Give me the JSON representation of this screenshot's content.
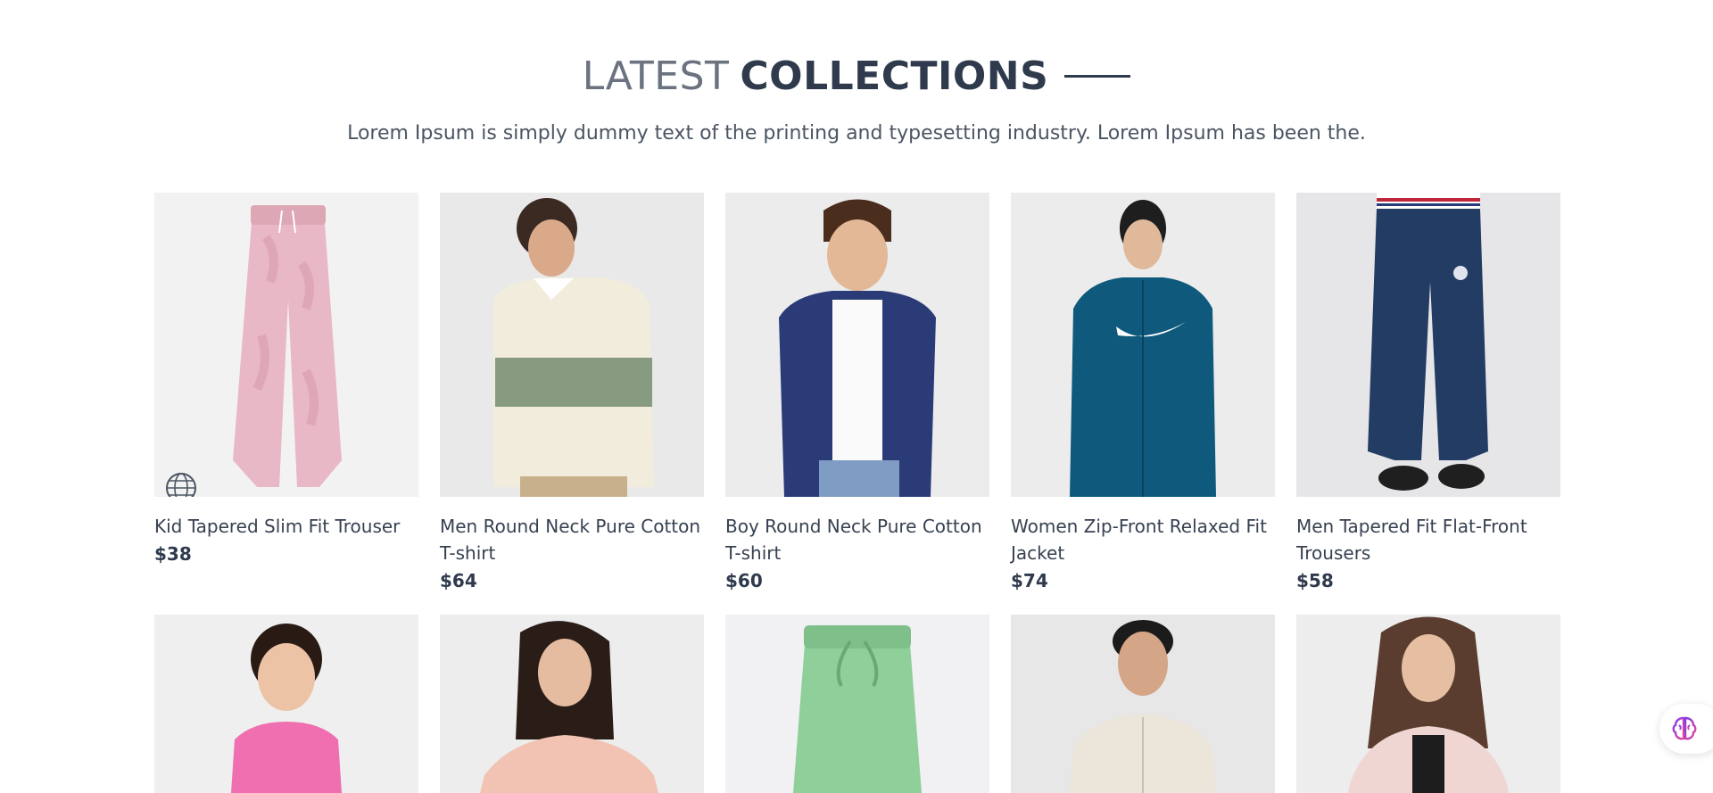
{
  "section": {
    "title_light": "LATEST",
    "title_bold": "COLLECTIONS",
    "subtitle": "Lorem Ipsum is simply dummy text of the printing and typesetting industry. Lorem Ipsum has been the."
  },
  "products_row1": [
    {
      "name": "Kid Tapered Slim Fit Trouser",
      "price": "$38"
    },
    {
      "name": "Men Round Neck Pure Cotton T-shirt",
      "price": "$64"
    },
    {
      "name": "Boy Round Neck Pure Cotton T-shirt",
      "price": "$60"
    },
    {
      "name": "Women Zip-Front Relaxed Fit Jacket",
      "price": "$74"
    },
    {
      "name": "Men Tapered Fit Flat-Front Trousers",
      "price": "$58"
    }
  ],
  "icons": {
    "globe": "globe-icon",
    "assistant": "brain-icon"
  },
  "colors": {
    "heading_dark": "#2f3a4d",
    "heading_light": "#6b7280",
    "background": "#ffffff"
  }
}
